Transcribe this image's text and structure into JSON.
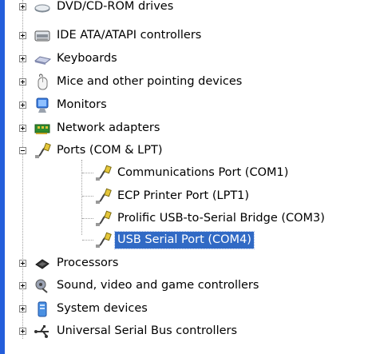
{
  "tree": {
    "items": [
      {
        "label": "DVD/CD-ROM drives",
        "icon": "dvd-drive-icon",
        "state": "collapsed"
      },
      {
        "label": "IDE ATA/ATAPI controllers",
        "icon": "ide-controller-icon",
        "state": "collapsed"
      },
      {
        "label": "Keyboards",
        "icon": "keyboard-icon",
        "state": "collapsed"
      },
      {
        "label": "Mice and other pointing devices",
        "icon": "mouse-icon",
        "state": "collapsed"
      },
      {
        "label": "Monitors",
        "icon": "monitor-icon",
        "state": "collapsed"
      },
      {
        "label": "Network adapters",
        "icon": "network-adapter-icon",
        "state": "collapsed"
      },
      {
        "label": "Ports (COM & LPT)",
        "icon": "port-icon",
        "state": "expanded"
      },
      {
        "label": "Communications Port (COM1)",
        "icon": "port-icon",
        "child": true
      },
      {
        "label": "ECP Printer Port (LPT1)",
        "icon": "port-icon",
        "child": true
      },
      {
        "label": "Prolific USB-to-Serial Bridge (COM3)",
        "icon": "port-icon",
        "child": true
      },
      {
        "label": "USB Serial Port (COM4)",
        "icon": "port-icon",
        "child": true,
        "selected": true
      },
      {
        "label": "Processors",
        "icon": "processor-icon",
        "state": "collapsed"
      },
      {
        "label": "Sound, video and game controllers",
        "icon": "sound-icon",
        "state": "collapsed"
      },
      {
        "label": "System devices",
        "icon": "system-device-icon",
        "state": "collapsed"
      },
      {
        "label": "Universal Serial Bus controllers",
        "icon": "usb-icon",
        "state": "collapsed"
      }
    ]
  },
  "colors": {
    "selection": "#316ac5",
    "left_bar": "#245edb"
  }
}
